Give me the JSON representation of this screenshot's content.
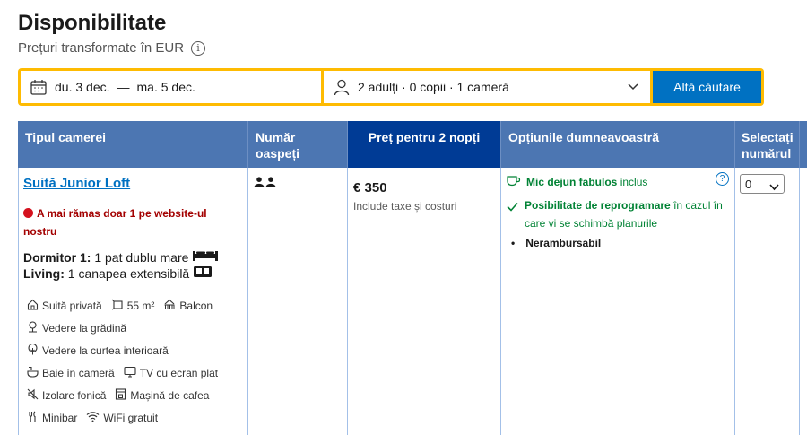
{
  "header": {
    "title": "Disponibilitate",
    "subtitle": "Prețuri transformate în EUR",
    "info_glyph": "i"
  },
  "search": {
    "checkin": "du. 3 dec.",
    "dash": "—",
    "checkout": "ma. 5 dec.",
    "guests": "2 adulți · 0 copii · 1 cameră",
    "button_label": "Altă căutare"
  },
  "table": {
    "headers": {
      "room_type": "Tipul camerei",
      "guests": "Număr oaspeți",
      "price": "Preț pentru 2 nopți",
      "options": "Opțiunile dumneavoastră",
      "select": "Selectați numărul"
    },
    "room": {
      "name": "Suită Junior Loft",
      "scarcity": "A mai rămas doar 1 pe website-ul nostru",
      "bed1_label": "Dormitor 1:",
      "bed1_value": "1 pat dublu mare",
      "bed2_label": "Living:",
      "bed2_value": "1 canapea extensibilă",
      "facilities": {
        "private_suite": "Suită privată",
        "size": "55 m²",
        "balcony": "Balcon",
        "garden_view": "Vedere la grădină",
        "courtyard_view": "Vedere la curtea interioară",
        "bathroom": "Baie în cameră",
        "tv": "TV cu ecran plat",
        "soundproof": "Izolare fonică",
        "coffee": "Mașină de cafea",
        "minibar": "Minibar",
        "wifi": "WiFi gratuit"
      }
    },
    "price": {
      "value": "€ 350",
      "note": "Include taxe și costuri"
    },
    "options": {
      "breakfast_bold": "Mic dejun fabulos",
      "breakfast_rest": "inclus",
      "reschedule_bold": "Posibilitate de reprogramare",
      "reschedule_rest": "în cazul în care vi se schimbă planurile",
      "nonrefundable": "Nerambursabil",
      "help_glyph": "?"
    },
    "select_value": "0"
  },
  "colors": {
    "accent": "#0071c2",
    "header_bg": "#4c76b2",
    "price_header_bg": "#003b95",
    "search_border": "#febb02",
    "success": "#008234",
    "danger": "#a30000"
  }
}
